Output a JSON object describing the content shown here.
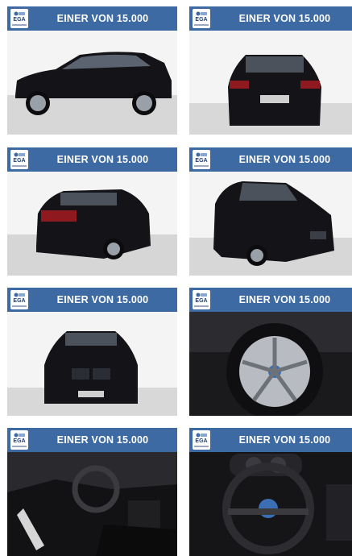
{
  "gallery": {
    "tiles": [
      {
        "banner": "EINER VON 15.000",
        "logo": "EGA",
        "view": "side-exterior"
      },
      {
        "banner": "EINER VON 15.000",
        "logo": "EGA",
        "view": "rear-exterior"
      },
      {
        "banner": "EINER VON 15.000",
        "logo": "EGA",
        "view": "rear-three-quarter-exterior"
      },
      {
        "banner": "EINER VON 15.000",
        "logo": "EGA",
        "view": "front-three-quarter-exterior"
      },
      {
        "banner": "EINER VON 15.000",
        "logo": "EGA",
        "view": "front-exterior"
      },
      {
        "banner": "EINER VON 15.000",
        "logo": "EGA",
        "view": "wheel-closeup"
      },
      {
        "banner": "EINER VON 15.000",
        "logo": "EGA",
        "view": "interior-dashboard"
      },
      {
        "banner": "EINER VON 15.000",
        "logo": "EGA",
        "view": "steering-wheel-closeup"
      }
    ]
  },
  "colors": {
    "banner": "#3d6aa3",
    "car": "#141418",
    "studio_wall": "#f4f4f4",
    "studio_floor": "#d8d8d8"
  }
}
